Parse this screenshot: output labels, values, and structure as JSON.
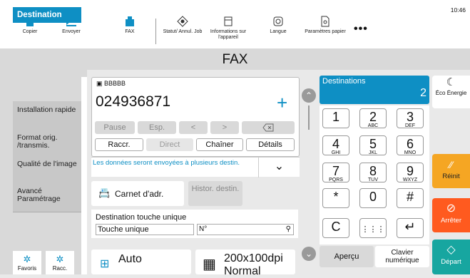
{
  "status": {
    "time": "10:46"
  },
  "toolbar": [
    {
      "label": "Copier",
      "icon": "copier-icon"
    },
    {
      "label": "Envoyer",
      "icon": "send-icon"
    },
    {
      "label": "FAX",
      "icon": "fax-icon"
    },
    {
      "label": "Statut/ Annul. Job",
      "icon": "status-icon"
    },
    {
      "label": "Informations sur l'appareil",
      "icon": "device-info-icon"
    },
    {
      "label": "Langue",
      "icon": "language-icon"
    },
    {
      "label": "Paramètres papier",
      "icon": "paper-settings-icon"
    },
    {
      "label": "•••",
      "icon": "more-icon"
    }
  ],
  "title": "FAX",
  "sidebar": {
    "items": [
      {
        "label": "Destination"
      },
      {
        "label": "Installation rapide"
      },
      {
        "label": "Format orig. /transmis."
      },
      {
        "label": "Qualité de l'image"
      },
      {
        "label": "Avancé Paramétrage"
      }
    ],
    "favoris": "Favoris",
    "racc": "Racc."
  },
  "destination": {
    "name": "BBBBB",
    "number": "024936871",
    "add": "+"
  },
  "keys": {
    "pause": "Pause",
    "esp": "Esp.",
    "left": "<",
    "right": ">",
    "raccr": "Raccr.",
    "direct": "Direct",
    "chainer": "Chaîner",
    "details": "Détails"
  },
  "info": "Les données seront envoyées à plusieurs destin.",
  "buttons": {
    "address_book": "Carnet d'adr.",
    "history": "Histor. destin."
  },
  "onetouch": {
    "title": "Destination touche unique",
    "field": "Touche unique",
    "number": "N°"
  },
  "bottom": {
    "auto": "Auto",
    "resolution": "200x100dpi",
    "quality": "Normal",
    "preview": "Aperçu",
    "keyboard": "Clavier numérique"
  },
  "destinations": {
    "label": "Destinations",
    "count": "2"
  },
  "keypad": [
    {
      "d": "1",
      "s": ""
    },
    {
      "d": "2",
      "s": "ABC"
    },
    {
      "d": "3",
      "s": "DEF"
    },
    {
      "d": "4",
      "s": "GHI"
    },
    {
      "d": "5",
      "s": "JKL"
    },
    {
      "d": "6",
      "s": "MNO"
    },
    {
      "d": "7",
      "s": "PQRS"
    },
    {
      "d": "8",
      "s": "TUV"
    },
    {
      "d": "9",
      "s": "WXYZ"
    },
    {
      "d": "*",
      "s": ""
    },
    {
      "d": "0",
      "s": ""
    },
    {
      "d": "#",
      "s": ""
    },
    {
      "d": "C",
      "s": ""
    },
    {
      "d": "⋮⋮⋮",
      "s": ""
    },
    {
      "d": "↵",
      "s": ""
    }
  ],
  "right": {
    "eco": "Éco Énergie",
    "reset": "Réinit",
    "stop": "Arrêter",
    "start": "Départ"
  },
  "colors": {
    "accent": "#0e8fc4",
    "reset": "#f5a623",
    "stop": "#ff5a1f",
    "start": "#17a6a0"
  }
}
